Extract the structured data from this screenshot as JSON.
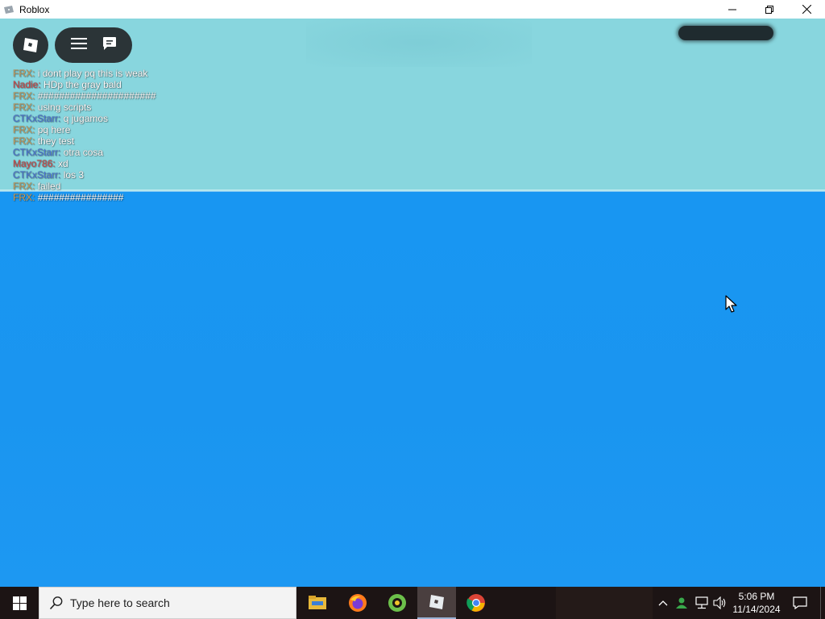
{
  "window": {
    "title": "Roblox",
    "icon": "roblox-app-icon",
    "controls": [
      "minimize-icon",
      "restore-icon",
      "close-icon"
    ]
  },
  "game": {
    "top_buttons": {
      "roblox_menu": "roblox-logo-icon",
      "hamburger": "hamburger-icon",
      "chat": "chat-icon"
    },
    "colors": {
      "sky": "#88d6de",
      "water": "#1a95f0",
      "ui_button": "#2b3437"
    }
  },
  "chat": {
    "messages": [
      {
        "name": "FRX:",
        "text": "i dont play pq this is weak",
        "color": "#c8a060"
      },
      {
        "name": "Nadie:",
        "text": "HDp the gray bald",
        "color": "#d04a4a"
      },
      {
        "name": "FRX:",
        "text": "######################",
        "color": "#c8a060"
      },
      {
        "name": "FRX:",
        "text": "using scripts",
        "color": "#c8a060"
      },
      {
        "name": "CTKxStarr:",
        "text": "q jugamos",
        "color": "#4a78d8"
      },
      {
        "name": "FRX:",
        "text": "pq here",
        "color": "#c8a060"
      },
      {
        "name": "FRX:",
        "text": "they test",
        "color": "#c8a060"
      },
      {
        "name": "CTKxStarr:",
        "text": "otra cosa",
        "color": "#4a78d8"
      },
      {
        "name": "Mayo786:",
        "text": "xd",
        "color": "#d04a4a"
      },
      {
        "name": "CTKxStarr:",
        "text": "los 3",
        "color": "#4a78d8"
      },
      {
        "name": "FRX:",
        "text": "failed",
        "color": "#c8a060"
      },
      {
        "name": "FRX:",
        "text": "################",
        "color": "#c8a060"
      }
    ]
  },
  "taskbar": {
    "search_placeholder": "Type here to search",
    "apps": [
      {
        "name": "file-explorer-icon"
      },
      {
        "name": "firefox-icon"
      },
      {
        "name": "app-green-icon"
      },
      {
        "name": "roblox-icon",
        "active": true
      },
      {
        "name": "chrome-icon"
      }
    ],
    "clock": {
      "time": "5:06 PM",
      "date": "11/14/2024"
    }
  }
}
